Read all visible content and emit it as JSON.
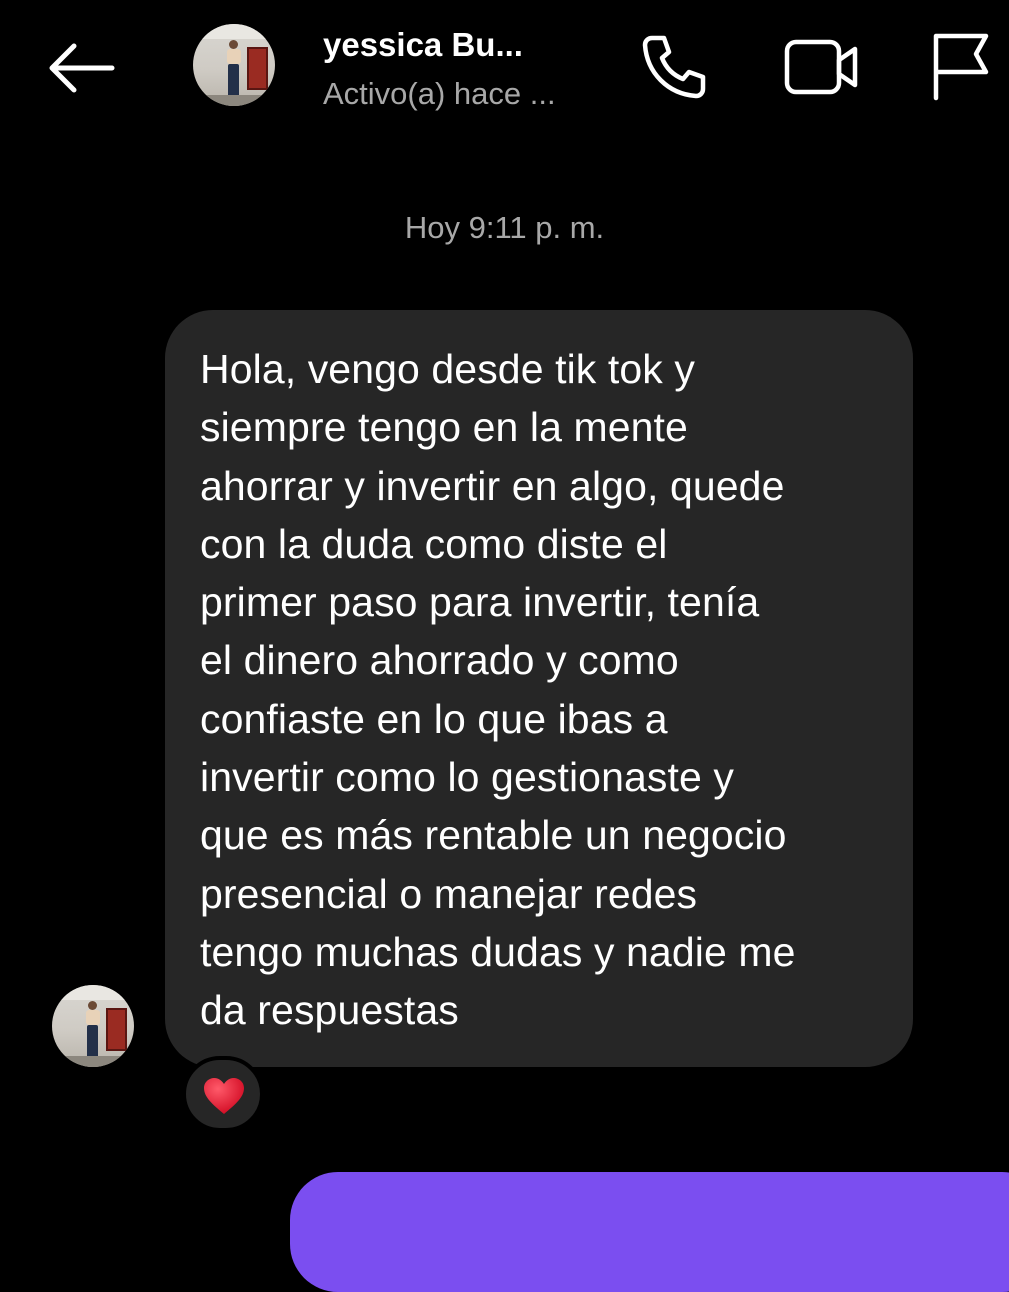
{
  "header": {
    "contact_name": "yessica Bu...",
    "status": "Activo(a) hace ...",
    "icons": {
      "back": "back-arrow-icon",
      "call": "phone-icon",
      "video": "video-camera-icon",
      "report": "flag-icon"
    }
  },
  "conversation": {
    "timestamp": "Hoy 9:11 p. m.",
    "messages": [
      {
        "direction": "incoming",
        "text": "Hola, vengo desde tik tok y\nsiempre tengo en la mente\nahorrar y invertir en algo, quede\ncon la duda como diste el\nprimer paso para invertir, tenía\nel dinero ahorrado y como\nconfiaste en lo que ibas a\ninvertir como lo gestionaste y\nque es más rentable un negocio\npresencial o manejar redes\ntengo muchas dudas y nadie me\nda respuestas",
        "reaction": "heart-reaction-icon"
      },
      {
        "direction": "outgoing",
        "text": ""
      }
    ]
  },
  "colors": {
    "background": "#000000",
    "incoming_bubble": "#262626",
    "outgoing_bubble": "#7b4ef0",
    "secondary_text": "#a8a8a8",
    "heart": "#e8112d"
  }
}
